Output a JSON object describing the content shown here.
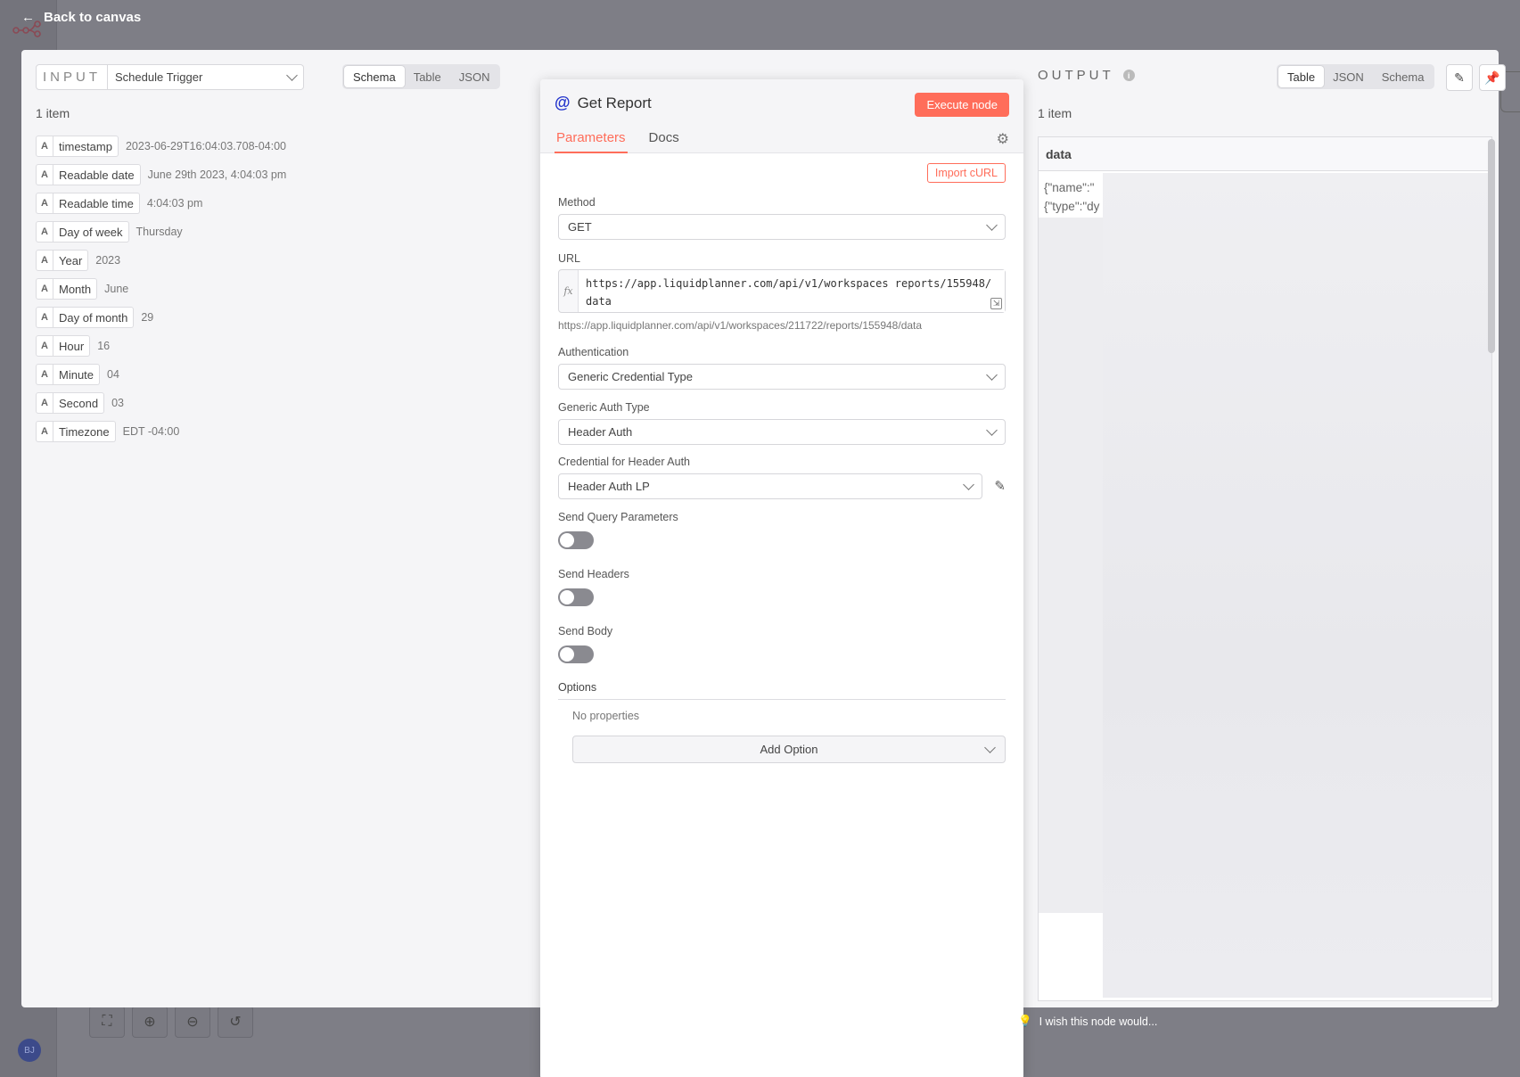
{
  "nav": {
    "back_label": "Back to canvas"
  },
  "canvas": {
    "avatar_initials": "BJ"
  },
  "input": {
    "label": "INPUT",
    "source_node": "Schedule Trigger",
    "view_tabs": [
      "Schema",
      "Table",
      "JSON"
    ],
    "active_view": "Schema",
    "item_count": "1 item",
    "fields": [
      {
        "type": "A",
        "key": "timestamp",
        "value": "2023-06-29T16:04:03.708-04:00"
      },
      {
        "type": "A",
        "key": "Readable date",
        "value": "June 29th 2023, 4:04:03 pm"
      },
      {
        "type": "A",
        "key": "Readable time",
        "value": "4:04:03 pm"
      },
      {
        "type": "A",
        "key": "Day of week",
        "value": "Thursday"
      },
      {
        "type": "A",
        "key": "Year",
        "value": "2023"
      },
      {
        "type": "A",
        "key": "Month",
        "value": "June"
      },
      {
        "type": "A",
        "key": "Day of month",
        "value": "29"
      },
      {
        "type": "A",
        "key": "Hour",
        "value": "16"
      },
      {
        "type": "A",
        "key": "Minute",
        "value": "04"
      },
      {
        "type": "A",
        "key": "Second",
        "value": "03"
      },
      {
        "type": "A",
        "key": "Timezone",
        "value": "EDT -04:00"
      }
    ]
  },
  "node": {
    "title": "Get Report",
    "execute_label": "Execute node",
    "tabs": [
      "Parameters",
      "Docs"
    ],
    "active_tab": "Parameters",
    "import_curl_label": "Import cURL",
    "method_label": "Method",
    "method_value": "GET",
    "url_label": "URL",
    "url_value": "https://app.liquidplanner.com/api/v1/workspaces           reports/155948/data",
    "url_resolved": "https://app.liquidplanner.com/api/v1/workspaces/211722/reports/155948/data",
    "auth_label": "Authentication",
    "auth_value": "Generic Credential Type",
    "generic_auth_label": "Generic Auth Type",
    "generic_auth_value": "Header Auth",
    "credential_label": "Credential for Header Auth",
    "credential_value": "Header Auth LP",
    "send_query_label": "Send Query Parameters",
    "send_headers_label": "Send Headers",
    "send_body_label": "Send Body",
    "send_query_on": false,
    "send_headers_on": false,
    "send_body_on": false,
    "options_label": "Options",
    "no_properties": "No properties",
    "add_option_label": "Add Option"
  },
  "output": {
    "label": "OUTPUT",
    "view_tabs": [
      "Table",
      "JSON",
      "Schema"
    ],
    "active_view": "Table",
    "item_count": "1 item",
    "column": "data",
    "cell_lines": [
      "{\"name\":\"",
      "{\"type\":\"dy"
    ]
  },
  "footer": {
    "wish_text": "I wish this node would..."
  },
  "colors": {
    "accent": "#ff6d5a",
    "node_icon": "#2233cc"
  }
}
